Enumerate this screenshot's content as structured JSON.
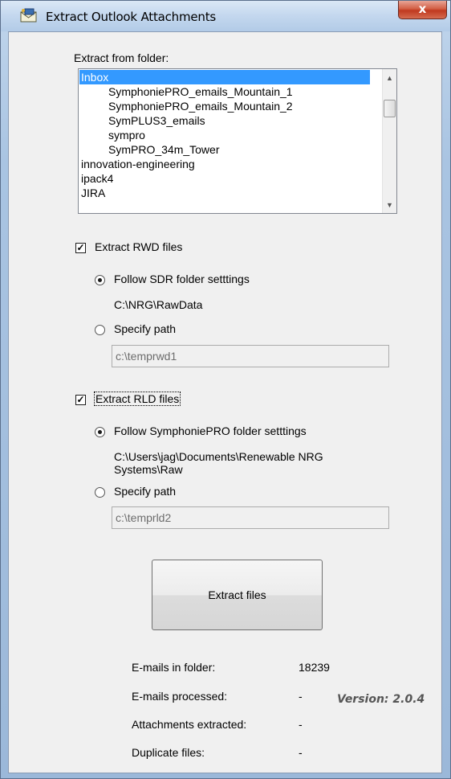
{
  "window": {
    "title": "Extract Outlook Attachments",
    "close_label": "x"
  },
  "folder": {
    "label": "Extract from folder:",
    "items": [
      {
        "label": "Inbox",
        "indent": 0,
        "selected": true
      },
      {
        "label": "SymphoniePRO_emails_Mountain_1",
        "indent": 1
      },
      {
        "label": "SymphoniePRO_emails_Mountain_2",
        "indent": 1
      },
      {
        "label": "SymPLUS3_emails",
        "indent": 1
      },
      {
        "label": "sympro",
        "indent": 1
      },
      {
        "label": "SymPRO_34m_Tower",
        "indent": 1
      },
      {
        "label": "innovation-engineering",
        "indent": 0
      },
      {
        "label": "ipack4",
        "indent": 0
      },
      {
        "label": "JIRA",
        "indent": 0
      }
    ]
  },
  "rwd": {
    "checkbox_label": "Extract RWD files",
    "checked": true,
    "follow_label": "Follow SDR folder setttings",
    "follow_path": "C:\\NRG\\RawData",
    "specify_label": "Specify path",
    "specify_value": "c:\\temprwd1"
  },
  "rld": {
    "checkbox_label": "Extract RLD files",
    "checked": true,
    "follow_label": "Follow SymphoniePRO folder setttings",
    "follow_path_line1": "C:\\Users\\jag\\Documents\\Renewable NRG",
    "follow_path_line2": "Systems\\Raw",
    "specify_label": "Specify path",
    "specify_value": "c:\\temprld2"
  },
  "extract_button": "Extract files",
  "stats": [
    {
      "label": "E-mails in folder:",
      "value": "18239"
    },
    {
      "label": "E-mails processed:",
      "value": "-"
    },
    {
      "label": "Attachments extracted:",
      "value": "-"
    },
    {
      "label": "Duplicate files:",
      "value": "-"
    }
  ],
  "version": "Version: 2.0.4",
  "colors": {
    "selection": "#3399ff",
    "close_button": "#c0391f"
  },
  "icons": {
    "title": "envelope-icon",
    "scroll_up": "triangle-up",
    "scroll_down": "triangle-down",
    "check": "check-mark"
  }
}
